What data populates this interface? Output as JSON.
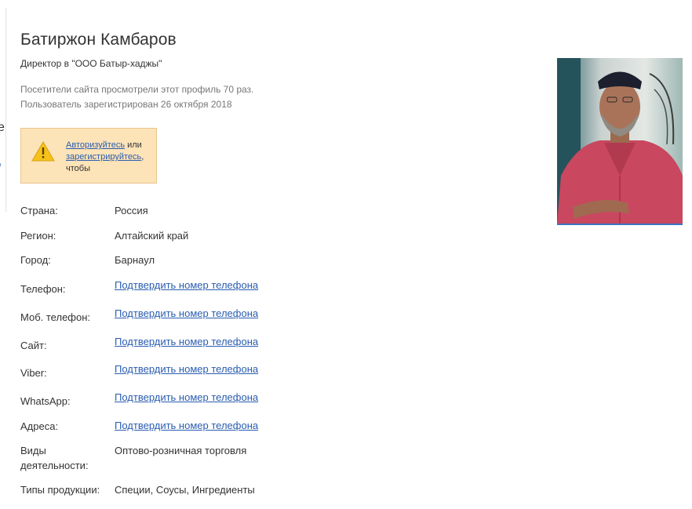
{
  "profile": {
    "name": "Батиржон Камбаров",
    "position": "Директор в \"ООО Батыр-хаджы\"",
    "views": "Посетители сайта просмотрели этот профиль 70 раз.",
    "registered": "Пользователь зарегистрирован 26 октября 2018"
  },
  "edge": {
    "char": "е",
    "mark": "/"
  },
  "notice": {
    "login_link": "Авторизуйтесь",
    "or_text": " или ",
    "register_link": "зарегистрируйтесь",
    "tail_text": ", чтобы",
    "icon": "warning-icon",
    "background": "#fde3b8"
  },
  "fields": {
    "country": {
      "label": "Страна:",
      "value": "Россия"
    },
    "region": {
      "label": "Регион:",
      "value": "Алтайский край"
    },
    "city": {
      "label": "Город:",
      "value": "Барнаул"
    },
    "phone": {
      "label": "Телефон:",
      "value": "Подтвердить номер телефона"
    },
    "mobile": {
      "label": "Моб. телефон:",
      "value": "Подтвердить номер телефона"
    },
    "site": {
      "label": "Сайт:",
      "value": "Подтвердить номер телефона"
    },
    "viber": {
      "label": "Viber:",
      "value": "Подтвердить номер телефона"
    },
    "whatsapp": {
      "label": "WhatsApp:",
      "value": "Подтвердить номер телефона"
    },
    "addresses": {
      "label": "Адреса:",
      "value": "Подтвердить номер телефона"
    },
    "activities": {
      "label_line1": "Виды",
      "label_line2": "деятельности:",
      "value": "Оптово-розничная торговля"
    },
    "products": {
      "label": "Типы продукции:",
      "value": "Специи, Соусы, Ингредиенты"
    }
  },
  "colors": {
    "link": "#2a5db0",
    "photo_border": "#3b74c4"
  }
}
